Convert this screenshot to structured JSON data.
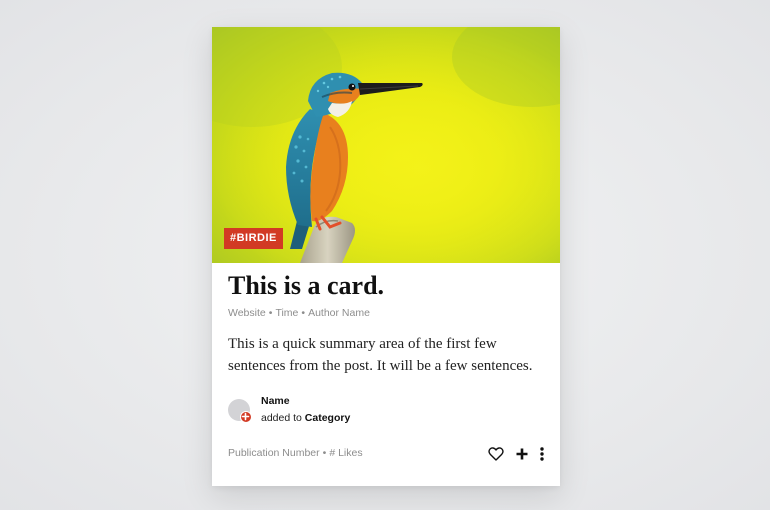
{
  "card": {
    "tag": "#BIRDIE",
    "title": "This is a card.",
    "meta": {
      "website": "Website",
      "time": "Time",
      "author": "Author Name",
      "separator": "•"
    },
    "summary": "This is a quick summary area of the first few sentences from the post. It will be a few sentences.",
    "activity": {
      "name": "Name",
      "action": "added to",
      "category": "Category"
    },
    "footer": {
      "publication": "Publication Number",
      "likes": "# Likes",
      "separator": "•"
    },
    "icons": {
      "hero": "kingfisher-photo",
      "like": "heart-icon",
      "add": "plus-icon",
      "more": "more-vertical-icon",
      "badge": "plus-circle-icon"
    }
  },
  "colors": {
    "tag_background": "#d23a24",
    "badge_background": "#d23a24",
    "page_background": "#e9eaec",
    "card_background": "#ffffff",
    "meta_text": "#8d8d8d"
  }
}
